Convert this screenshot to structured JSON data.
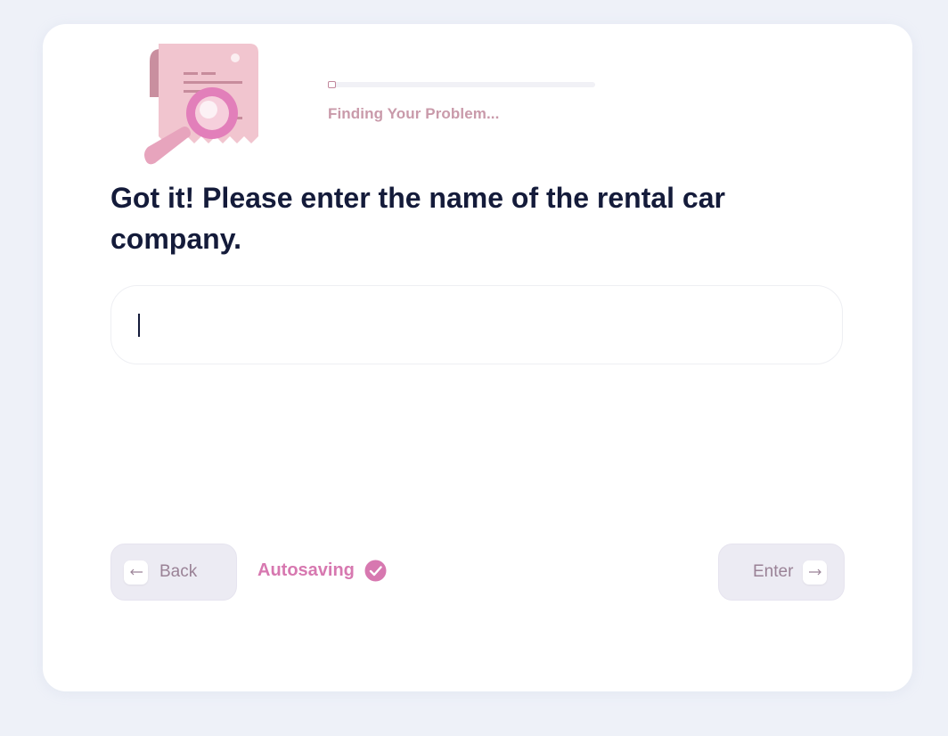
{
  "progress": {
    "label": "Finding Your Problem...",
    "fraction": 0.03
  },
  "question": {
    "text": "Got it! Please enter the name of the rental car company."
  },
  "answer": {
    "value": "",
    "placeholder": ""
  },
  "footer": {
    "back_label": "Back",
    "autosave_label": "Autosaving",
    "enter_label": "Enter"
  },
  "icons": {
    "illustration": "receipt-magnifier-icon",
    "back": "arrow-left-icon",
    "enter": "arrow-right-icon",
    "autosave": "checkmark-circle-icon"
  },
  "colors": {
    "background": "#eef1f8",
    "card": "#ffffff",
    "heading": "#141b3a",
    "accent_pink": "#d778b0",
    "progress_label": "#c99aaa",
    "button_bg": "#ecebf3",
    "button_text": "#9a8296"
  }
}
